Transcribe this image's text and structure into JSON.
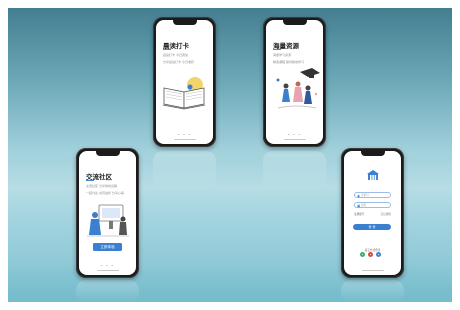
{
  "screens": {
    "reading": {
      "title": "晨读打卡",
      "lines": [
        "晨读打卡 今日阅读",
        "分享晨读打卡 今日收获"
      ],
      "pager": "• • •"
    },
    "resources": {
      "title": "海量资源",
      "lines": [
        "海量学习资源",
        "精选课程 随时随地学习"
      ],
      "pager": "• • •"
    },
    "community": {
      "title": "交流社区",
      "lines": [
        "交流社区 分享你的见解",
        "一起讨论 共同进步 分享心得"
      ],
      "button_label": "立即体验",
      "pager": "• • •"
    },
    "login": {
      "username_placeholder": "手机号",
      "password_placeholder": "密码",
      "register_link": "注册账号",
      "forgot_link": "忘记密码",
      "login_label": "登 录",
      "other_login_label": "其它方式登录"
    }
  },
  "colors": {
    "accent": "#3a7fd0",
    "social_wechat": "#2fb56a",
    "social_weibo": "#e2463f",
    "social_qq": "#3b86d8"
  }
}
